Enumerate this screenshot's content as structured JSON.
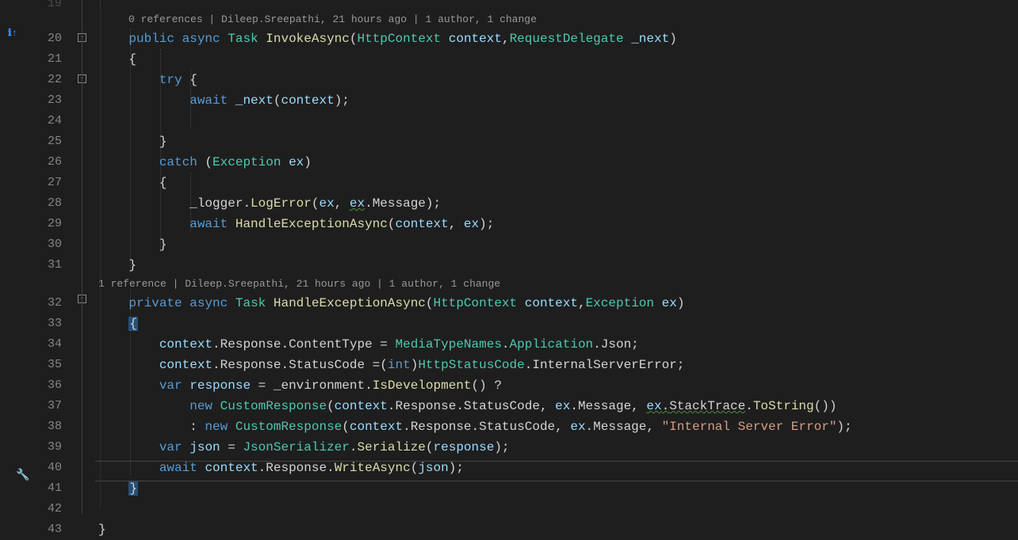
{
  "lineStart": 19,
  "dimLine": "19",
  "lines": [
    "19",
    "20",
    "21",
    "22",
    "23",
    "24",
    "25",
    "26",
    "27",
    "28",
    "29",
    "30",
    "31",
    "32",
    "33",
    "34",
    "35",
    "36",
    "37",
    "38",
    "39",
    "40",
    "41",
    "42",
    "43"
  ],
  "codelens1": "0 references | Dileep.Sreepathi, 21 hours ago | 1 author, 1 change",
  "codelens2": "1 reference | Dileep.Sreepathi, 21 hours ago | 1 author, 1 change",
  "code": {
    "l20": {
      "public": "public",
      "async": "async",
      "task": "Task",
      "method": "InvokeAsync",
      "httpctx": "HttpContext",
      "ctx": "context",
      "reqdel": "RequestDelegate",
      "next": "_next"
    },
    "l21": "{",
    "l22": {
      "try": "try",
      "brace": "{"
    },
    "l23": {
      "await": "await",
      "next": "_next",
      "ctx": "context"
    },
    "l25": "}",
    "l26": {
      "catch": "catch",
      "exc": "Exception",
      "ex": "ex"
    },
    "l27": "{",
    "l28": {
      "logger": "_logger",
      "logerr": "LogError",
      "ex": "ex",
      "msg": "Message"
    },
    "l29": {
      "await": "await",
      "handle": "HandleExceptionAsync",
      "ctx": "context",
      "ex": "ex"
    },
    "l30": "}",
    "l31": "}",
    "l32": {
      "private": "private",
      "async": "async",
      "task": "Task",
      "method": "HandleExceptionAsync",
      "httpctx": "HttpContext",
      "ctx": "context",
      "exc": "Exception",
      "ex": "ex"
    },
    "l33": "{",
    "l34": {
      "ctx": "context",
      "resp": "Response",
      "ct": "ContentType",
      "mtn": "MediaTypeNames",
      "app": "Application",
      "json": "Json"
    },
    "l35": {
      "ctx": "context",
      "resp": "Response",
      "sc": "StatusCode",
      "int": "int",
      "hsc": "HttpStatusCode",
      "ise": "InternalServerError"
    },
    "l36": {
      "var": "var",
      "response": "response",
      "env": "_environment",
      "isdev": "IsDevelopment"
    },
    "l37": {
      "new": "new",
      "cr": "CustomResponse",
      "ctx": "context",
      "resp": "Response",
      "sc": "StatusCode",
      "ex": "ex",
      "msg": "Message",
      "st": "StackTrace",
      "tos": "ToString"
    },
    "l38": {
      "new": "new",
      "cr": "CustomResponse",
      "ctx": "context",
      "resp": "Response",
      "sc": "StatusCode",
      "ex": "ex",
      "msg": "Message",
      "str": "\"Internal Server Error\""
    },
    "l39": {
      "var": "var",
      "json": "json",
      "js": "JsonSerializer",
      "ser": "Serialize",
      "response": "response"
    },
    "l40": {
      "await": "await",
      "ctx": "context",
      "resp": "Response",
      "wa": "WriteAsync",
      "json": "json"
    },
    "l41": "}",
    "l43": "}"
  },
  "icons": {
    "info": "ℹ↑",
    "wrench": "🔧",
    "minus": "-"
  }
}
